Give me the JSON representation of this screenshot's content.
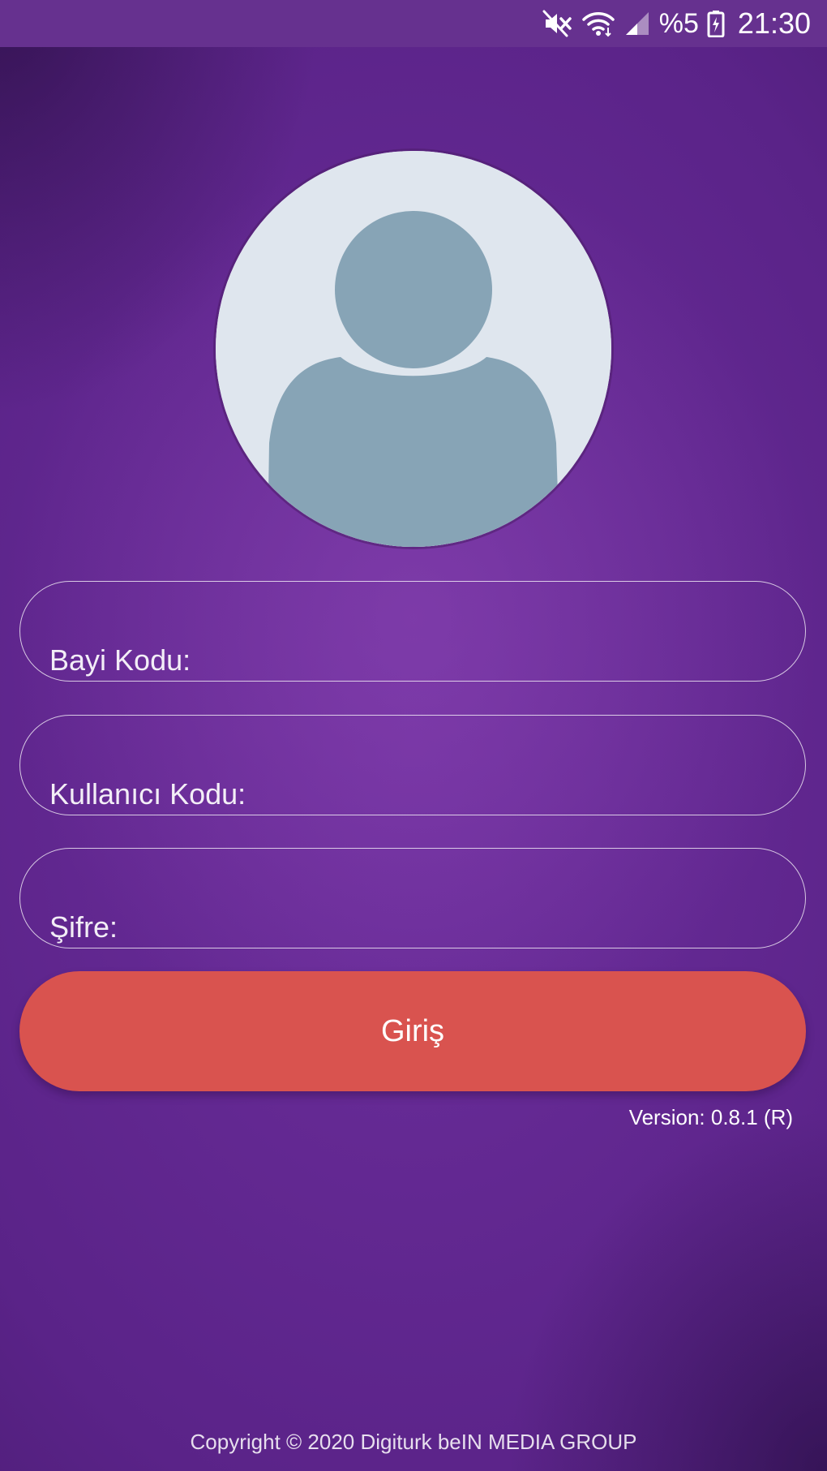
{
  "status_bar": {
    "battery_text": "%5",
    "time": "21:30",
    "icons": [
      "mute-icon",
      "wifi-icon",
      "signal-icon",
      "battery-icon"
    ]
  },
  "avatar": {
    "icon": "user-avatar-icon",
    "colors": {
      "circle": "#dfe6ee",
      "figure": "#87a4b6"
    }
  },
  "form": {
    "fields": [
      {
        "id": "dealer_code",
        "label": "Bayi Kodu:",
        "value": ""
      },
      {
        "id": "user_code",
        "label": "Kullanıcı Kodu:",
        "value": ""
      },
      {
        "id": "password",
        "label": "Şifre:",
        "value": ""
      }
    ],
    "submit_label": "Giriş"
  },
  "version": "Version: 0.8.1 (R)",
  "copyright": "Copyright © 2020 Digiturk beIN MEDIA GROUP",
  "colors": {
    "background": "#5a2388",
    "status_bar": "#66318f",
    "button": "#d9534f",
    "text": "#ffffff"
  }
}
